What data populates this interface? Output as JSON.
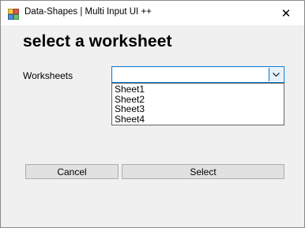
{
  "window": {
    "title": "Data-Shapes | Multi Input UI ++",
    "close_glyph": "✕"
  },
  "form": {
    "heading": "select a worksheet",
    "worksheets_label": "Worksheets",
    "worksheets_value": "",
    "worksheet_options": [
      "Sheet1",
      "Sheet2",
      "Sheet3",
      "Sheet4"
    ]
  },
  "buttons": {
    "cancel_label": "Cancel",
    "select_label": "Select"
  },
  "colors": {
    "focus_border": "#0078d7",
    "button_bg": "#e1e1e1",
    "window_bg": "#f0f0f0"
  },
  "icons": {
    "app": "app-icon",
    "close": "close-icon",
    "dropdown": "chevron-down-icon"
  }
}
